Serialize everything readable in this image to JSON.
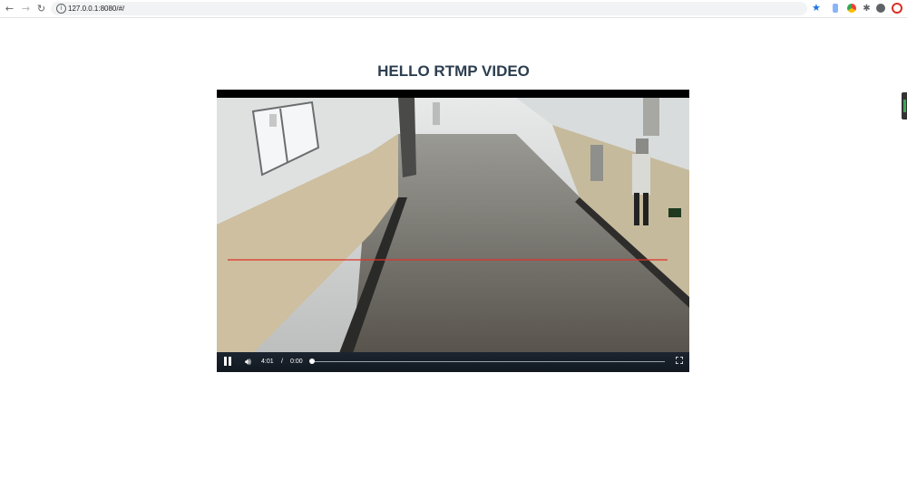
{
  "browser": {
    "url": "127.0.0.1:8080/#/",
    "icons": [
      "back-arrow-icon",
      "forward-arrow-icon",
      "reload-icon",
      "site-info-icon",
      "bookmark-star-icon",
      "extension-icon",
      "chrome-icon",
      "puzzle-icon",
      "account-icon",
      "opera-icon"
    ]
  },
  "page": {
    "title": "HELLO RTMP VIDEO"
  },
  "player": {
    "current_time": "4:01",
    "separator": "/",
    "duration": "0:00",
    "progress": 0
  },
  "colors": {
    "title": "#2c3e50",
    "controls_bg": "#1c2530",
    "overlay_line": "#e0312a"
  }
}
